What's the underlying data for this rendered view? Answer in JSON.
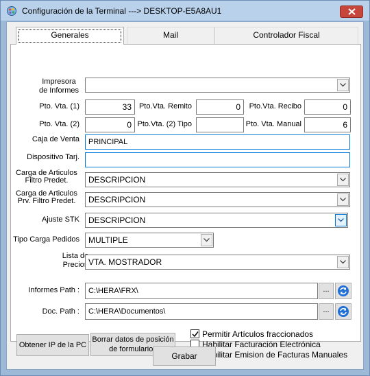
{
  "window": {
    "title": "Configuración de la Terminal ---> DESKTOP-E5A8AU1"
  },
  "tabs": [
    {
      "label": "Generales"
    },
    {
      "label": "Mail"
    },
    {
      "label": "Controlador Fiscal"
    }
  ],
  "form": {
    "impresora_label": "Impresora\nde Informes",
    "impresora_value": "",
    "pto_vta_1_label": "Pto. Vta. (1)",
    "pto_vta_1_value": "33",
    "pto_vta_remito_label": "Pto.Vta. Remito",
    "pto_vta_remito_value": "0",
    "pto_vta_recibo_label": "Pto.Vta. Recibo",
    "pto_vta_recibo_value": "0",
    "pto_vta_2_label": "Pto. Vta. (2)",
    "pto_vta_2_value": "0",
    "pto_vta_2_tipo_label": "Pto.Vta. (2) Tipo",
    "pto_vta_2_tipo_value": "",
    "pto_vta_manual_label": "Pto. Vta. Manual",
    "pto_vta_manual_value": "6",
    "caja_label": "Caja de Venta",
    "caja_value": "PRINCIPAL",
    "dispositivo_label": "Dispositivo Tarj.",
    "dispositivo_value": "",
    "carga_articulos_label": "Carga de Articulos\nFiltro Predet.",
    "carga_articulos_value": "DESCRIPCION",
    "carga_articulos_prv_label": "Carga de Articulos\nPrv. Filtro Predet.",
    "carga_articulos_prv_value": "DESCRIPCION",
    "ajuste_stk_label": "Ajuste STK",
    "ajuste_stk_value": "DESCRIPCION",
    "tipo_carga_label": "Tipo Carga Pedidos",
    "tipo_carga_value": "MULTIPLE",
    "lista_precios_label": "Lista de\nPrecios",
    "lista_precios_value": "VTA. MOSTRADOR",
    "informes_path_label": "Informes Path :",
    "informes_path_value": "C:\\HERA\\FRX\\",
    "doc_path_label": "Doc. Path :",
    "doc_path_value": "C:\\HERA\\Documentos\\",
    "browse_label": "..."
  },
  "buttons": {
    "obtener_ip": "Obtener IP de la PC",
    "borrar_datos": "Borrar datos de posición\nde formularios",
    "grabar": "Grabar"
  },
  "checkboxes": [
    {
      "label": "Permitir Artículos fraccionados",
      "checked": true
    },
    {
      "label": "Habilitar Facturación Electrónica",
      "checked": false
    },
    {
      "label": "Habilitar Emision de Facturas Manuales",
      "checked": true
    }
  ],
  "icons": {
    "app": "gear-palette-icon",
    "close": "close-icon",
    "dropdown": "chevron-down-icon",
    "refresh": "refresh-icon",
    "check": "check-icon"
  },
  "colors": {
    "titlebar": "#b9d1ea",
    "close": "#c7463c",
    "focus": "#0078d7",
    "refresh": "#1f6fd6"
  }
}
